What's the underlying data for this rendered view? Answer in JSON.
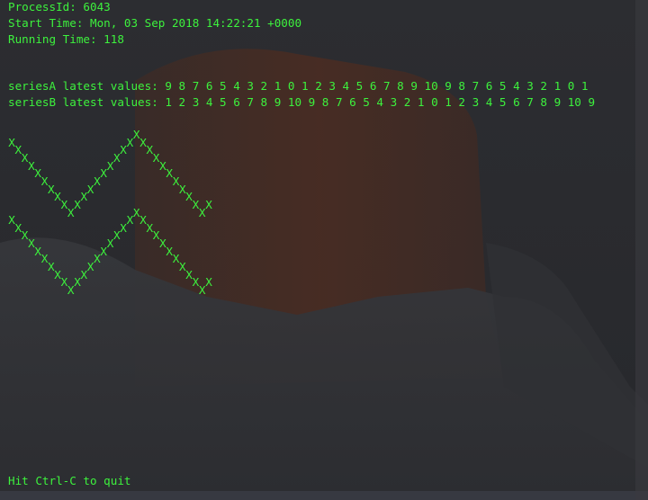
{
  "terminal": {
    "process_line": "ProcessId: 6043",
    "start_line": "Start Time: Mon, 03 Sep 2018 14:22:21 +0000",
    "running_line": "Running Time: 118",
    "seriesA_line": "seriesA latest values: 9 8 7 6 5 4 3 2 1 0 1 2 3 4 5 6 7 8 9 10 9 8 7 6 5 4 3 2 1 0 1",
    "seriesB_line": "seriesB latest values: 1 2 3 4 5 6 7 8 9 10 9 8 7 6 5 4 3 2 1 0 1 2 3 4 5 6 7 8 9 10 9",
    "quit_hint": "Hit Ctrl-C to quit",
    "plot_char": "X",
    "text_color": "#3df23d"
  },
  "chart_data": {
    "type": "scatter",
    "title": "",
    "xlabel": "",
    "ylabel": "",
    "ylim": [
      0,
      10
    ],
    "series": [
      {
        "name": "seriesA",
        "values": [
          9,
          8,
          7,
          6,
          5,
          4,
          3,
          2,
          1,
          0,
          1,
          2,
          3,
          4,
          5,
          6,
          7,
          8,
          9,
          10,
          9,
          8,
          7,
          6,
          5,
          4,
          3,
          2,
          1,
          0,
          1
        ]
      },
      {
        "name": "seriesB",
        "values": [
          1,
          2,
          3,
          4,
          5,
          6,
          7,
          8,
          9,
          10,
          9,
          8,
          7,
          6,
          5,
          4,
          3,
          2,
          1,
          0,
          1,
          2,
          3,
          4,
          5,
          6,
          7,
          8,
          9,
          10,
          9
        ]
      }
    ]
  }
}
